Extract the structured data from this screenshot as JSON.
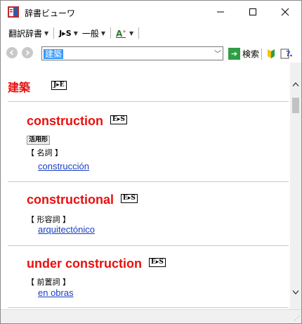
{
  "window": {
    "title": "辞書ビューワ",
    "controls": {
      "minimize": "—",
      "maximize": "☐",
      "close": "✕"
    }
  },
  "menubar": {
    "dict_menu": "翻訳辞書",
    "lang_pair": "J▸S",
    "mode": "一般",
    "font_icon": "font-size-icon"
  },
  "searchbar": {
    "query": "建築",
    "search_label": "検索"
  },
  "content": {
    "headword": "建築",
    "headword_badge": "J▸E",
    "entries": [
      {
        "title": "construction",
        "badge": "E▸S",
        "tag": "活用形",
        "pos": "【 名詞 】",
        "translation": "construcción"
      },
      {
        "title": "constructional",
        "badge": "E▸S",
        "tag": "",
        "pos": "【 形容詞 】",
        "translation": "arquitectónico"
      },
      {
        "title": "under construction",
        "badge": "E▸S",
        "tag": "",
        "pos": "【 前置詞 】",
        "translation": "en obras"
      }
    ]
  },
  "colors": {
    "headword": "#e8100e",
    "link": "#1a3fbf",
    "selection": "#3399ff",
    "search_go": "#2f9e44"
  }
}
